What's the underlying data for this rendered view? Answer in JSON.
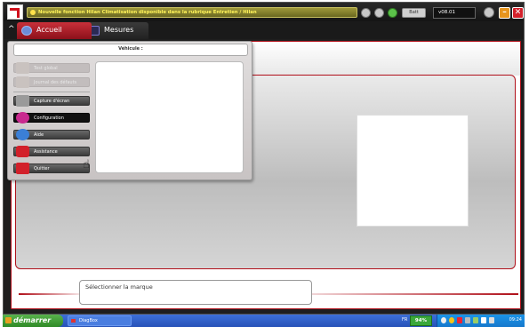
{
  "titlebar": {
    "notice": "Nouvelle fonction Hilan Climatisation disponible dans la rubrique Entretien / Hilan",
    "battery_label": "Batt",
    "version": "v08.01"
  },
  "tabs": [
    {
      "label": "Accueil"
    },
    {
      "label": "Mesures"
    }
  ],
  "menu": {
    "vehicle_label": "Véhicule :",
    "items": [
      {
        "label": "Test global",
        "state": "disabled"
      },
      {
        "label": "Journal des défauts",
        "state": "disabled"
      },
      {
        "label": "Capture d'écran",
        "state": "normal"
      },
      {
        "label": "Configuration",
        "state": "selected"
      },
      {
        "label": "Aide",
        "state": "normal"
      },
      {
        "label": "Assistance",
        "state": "normal"
      },
      {
        "label": "Quitter",
        "state": "normal"
      }
    ]
  },
  "status_message": "Sélectionner la marque",
  "taskbar": {
    "start_label": "démarrer",
    "task_label": "DiagBox",
    "language": "FR",
    "battery_percent": "94%",
    "clock": "09:24"
  },
  "colors": {
    "accent": "#b0101a",
    "notice_text": "#fff35a"
  }
}
